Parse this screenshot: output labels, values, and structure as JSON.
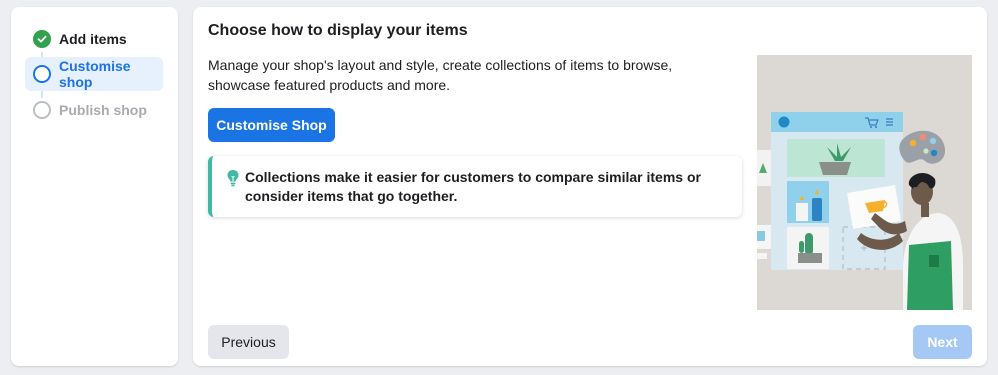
{
  "stepper": {
    "steps": [
      {
        "label": "Add items",
        "state": "completed"
      },
      {
        "label": "Customise shop",
        "state": "active"
      },
      {
        "label": "Publish shop",
        "state": "upcoming"
      }
    ]
  },
  "main": {
    "title": "Choose how to display your items",
    "description": "Manage your shop's layout and style, create collections of items to browse, showcase featured products and more.",
    "primary_button": "Customise Shop",
    "tip": {
      "icon": "lightbulb-icon",
      "text": "Collections make it easier for customers to compare similar items or consider items that go together."
    }
  },
  "footer": {
    "previous_label": "Previous",
    "next_label": "Next"
  },
  "colors": {
    "accent": "#1b74e4",
    "complete": "#31a24c",
    "tip_border": "#42b8a2",
    "next_disabled": "#a6c8f4"
  }
}
